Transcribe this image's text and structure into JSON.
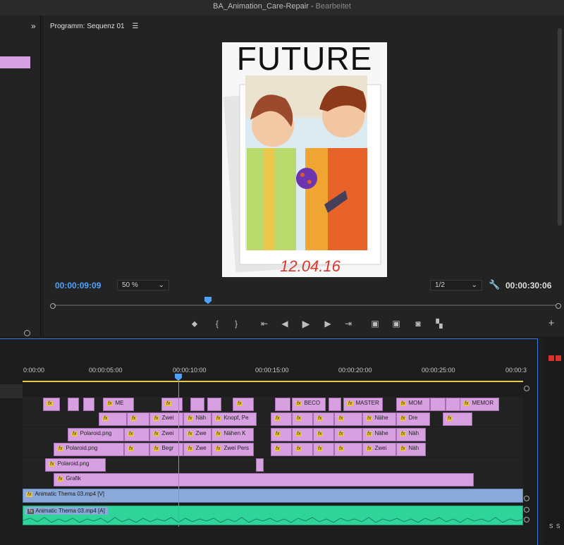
{
  "window": {
    "title": "BA_Animation_Care-Repair",
    "status": "Bearbeitet"
  },
  "program_monitor": {
    "title": "Programm: Sequenz 01",
    "menu_icon": "hamburger-icon",
    "timecode_current": "00:00:09:09",
    "zoom": "50 %",
    "resolution": "1/2",
    "timecode_total": "00:00:30:06",
    "playhead_fraction": 0.31
  },
  "preview": {
    "headline": "FUTURE",
    "date": "12.04.16"
  },
  "timeline": {
    "ruler": [
      "0:00:00",
      "00:00:05:00",
      "00:00:10:00",
      "00:00:15:00",
      "00:00:20:00",
      "00:00:25:00",
      "00:00:3"
    ],
    "playhead_time": "00:00:09:09",
    "video_track_label": "Animatic Thema 03.mp4 [V]",
    "audio_track_label": "Animatic Thema 03.mp4 [A]",
    "clips_v6": [
      "ME",
      "BECO",
      "MASTER",
      "MOM",
      "MEMOR"
    ],
    "clips_v5": [
      "Zwei",
      "Näh",
      "Knopf, Pe",
      "Dre",
      "Nähe"
    ],
    "clips_v4": [
      "Polaroid.png",
      "Zwei",
      "Zwe",
      "Nähen K",
      "Nähe",
      "Näh"
    ],
    "clips_v3": [
      "Polaroid.png",
      "Begr",
      "Zwe",
      "Zwei Pers",
      "Zwei",
      "Näh"
    ],
    "clips_v2": [
      "Polaroid.png"
    ],
    "clips_v1": [
      "Grafik"
    ]
  },
  "colors": {
    "accent": "#4ea2ff",
    "clip": "#d7a0e0",
    "video": "#8aa9d9",
    "audio": "#2fd49b"
  }
}
